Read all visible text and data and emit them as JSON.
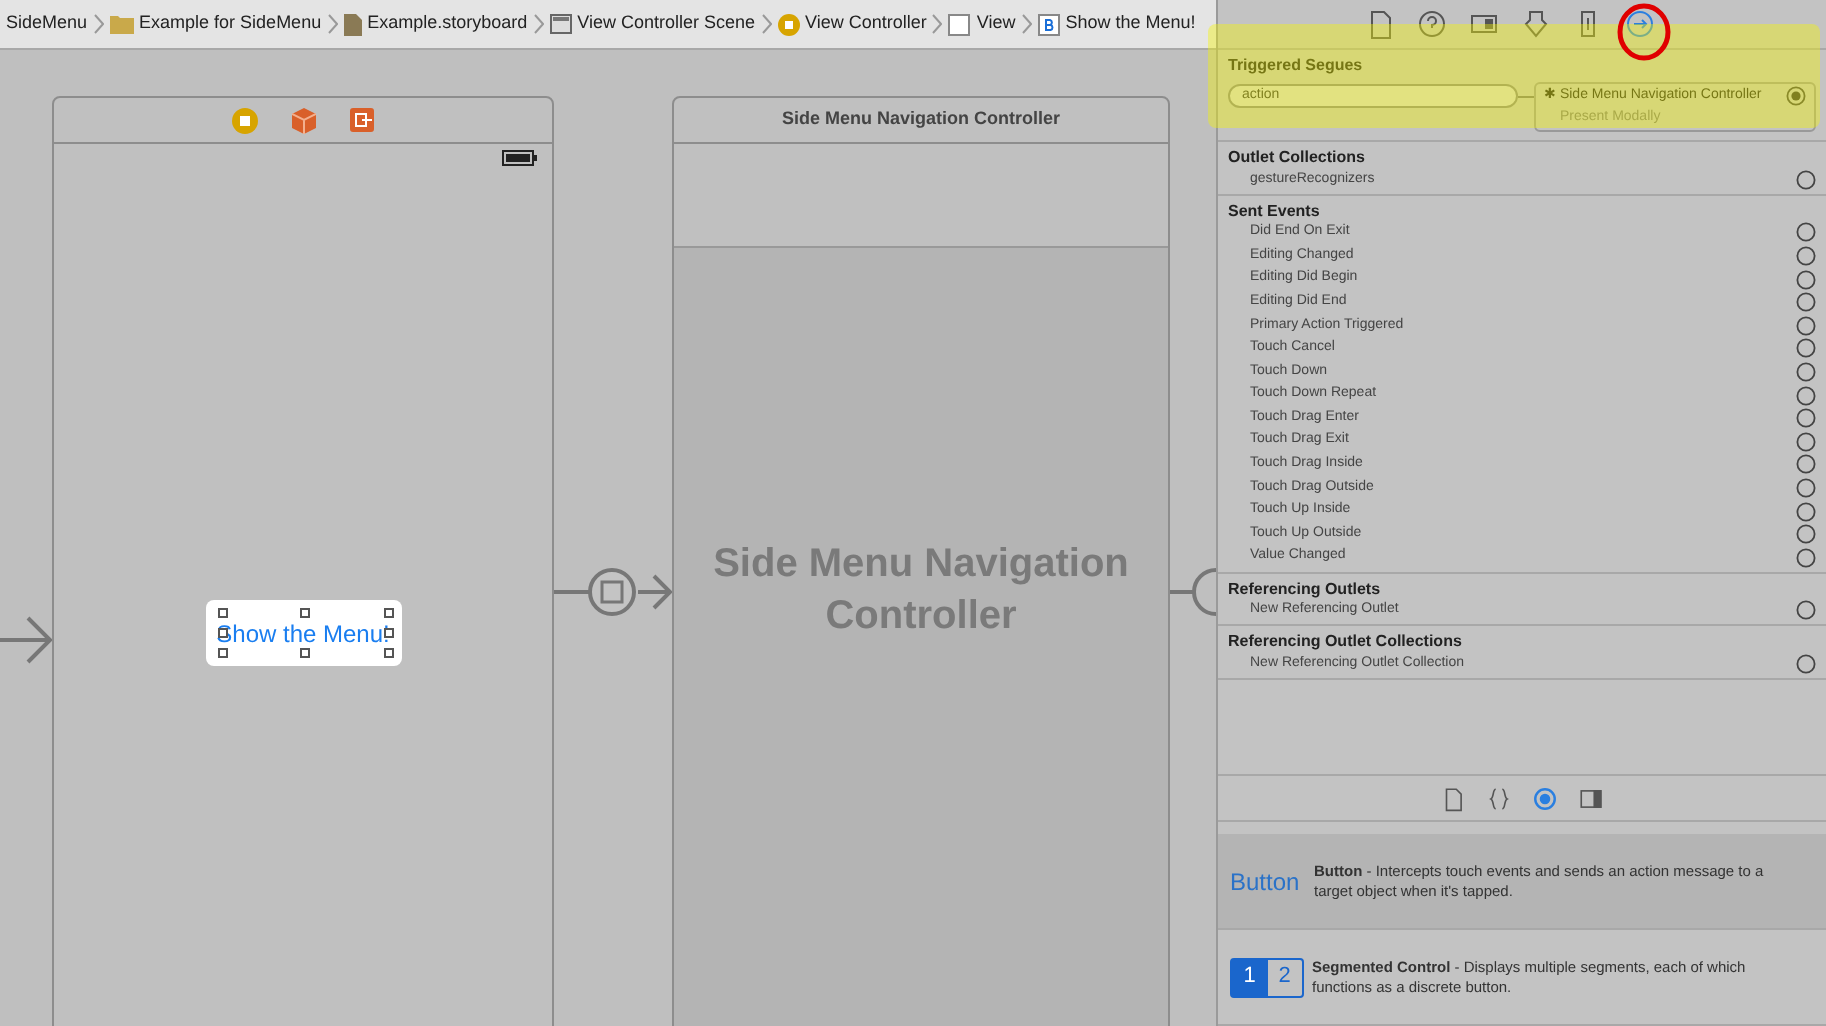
{
  "breadcrumb": [
    {
      "label": "SideMenu",
      "kind": "none"
    },
    {
      "label": "Example for SideMenu",
      "kind": "folder"
    },
    {
      "label": "Example.storyboard",
      "kind": "storyboard"
    },
    {
      "label": "View Controller Scene",
      "kind": "scene"
    },
    {
      "label": "View Controller",
      "kind": "controller"
    },
    {
      "label": "View",
      "kind": "view"
    },
    {
      "label": "Show the Menu!",
      "kind": "button"
    }
  ],
  "canvas": {
    "view_controller": {
      "button_label": "Show the Menu!"
    },
    "navigation_controller": {
      "title": "Side Menu Navigation Controller",
      "placeholder": "Side Menu Navigation Controller"
    }
  },
  "inspector": {
    "tabs": [
      {
        "selected": false
      },
      {
        "selected": false
      },
      {
        "selected": false
      },
      {
        "selected": false
      },
      {
        "selected": false
      },
      {
        "selected": true
      }
    ],
    "triggered_segues": {
      "title": "Triggered Segues",
      "segue": "action",
      "destination_icon": "✱",
      "destination": "Side Menu Navigation Controller",
      "style": "Present Modally",
      "connected": true
    },
    "sections": [
      {
        "title": "Outlet Collections",
        "rows": [
          {
            "label": "gestureRecognizers",
            "connected": false
          }
        ]
      },
      {
        "title": "Sent Events",
        "rows": [
          {
            "label": "Did End On Exit",
            "connected": false
          },
          {
            "label": "Editing Changed",
            "connected": false
          },
          {
            "label": "Editing Did Begin",
            "connected": false
          },
          {
            "label": "Editing Did End",
            "connected": false
          },
          {
            "label": "Primary Action Triggered",
            "connected": false
          },
          {
            "label": "Touch Cancel",
            "connected": false
          },
          {
            "label": "Touch Down",
            "connected": false
          },
          {
            "label": "Touch Down Repeat",
            "connected": false
          },
          {
            "label": "Touch Drag Enter",
            "connected": false
          },
          {
            "label": "Touch Drag Exit",
            "connected": false
          },
          {
            "label": "Touch Drag Inside",
            "connected": false
          },
          {
            "label": "Touch Drag Outside",
            "connected": false
          },
          {
            "label": "Touch Up Inside",
            "connected": false
          },
          {
            "label": "Touch Up Outside",
            "connected": false
          },
          {
            "label": "Value Changed",
            "connected": false
          }
        ]
      },
      {
        "title": "Referencing Outlets",
        "rows": [
          {
            "label": "New Referencing Outlet",
            "connected": false
          }
        ]
      },
      {
        "title": "Referencing Outlet Collections",
        "rows": [
          {
            "label": "New Referencing Outlet Collection",
            "connected": false
          }
        ]
      }
    ]
  },
  "library_tabs": [
    {
      "selected": false
    },
    {
      "selected": false
    },
    {
      "selected": true
    },
    {
      "selected": false
    }
  ],
  "library": [
    {
      "kind": "button",
      "preview": "Button",
      "name": "Button",
      "description": "- Intercepts touch events and sends an action message to a target object when it's tapped.",
      "selected": true
    },
    {
      "kind": "segmented",
      "preview": [
        "1",
        "2"
      ],
      "name": "Segmented Control",
      "description": "- Displays multiple segments, each of which functions as a discrete button.",
      "selected": false
    }
  ]
}
